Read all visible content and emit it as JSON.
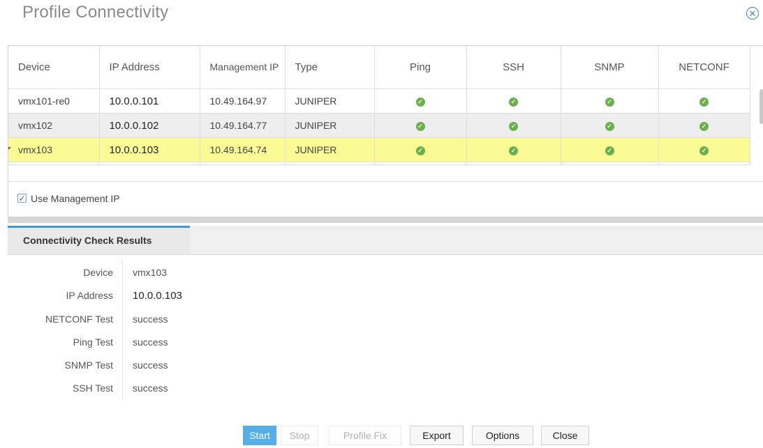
{
  "dialog": {
    "title": "Profile Connectivity",
    "close_icon": "close-circle-icon"
  },
  "table": {
    "columns": {
      "device": "Device",
      "ip_address": "IP Address",
      "management_ip": "Management IP",
      "type": "Type",
      "ping": "Ping",
      "ssh": "SSH",
      "snmp": "SNMP",
      "netconf": "NETCONF"
    },
    "rows": [
      {
        "device": "vmx101-re0",
        "ip_address": "10.0.0.101",
        "management_ip": "10.49.164.97",
        "type": "JUNIPER"
      },
      {
        "device": "vmx102",
        "ip_address": "10.0.0.102",
        "management_ip": "10.49.164.77",
        "type": "JUNIPER"
      },
      {
        "device": "vmx103",
        "ip_address": "10.0.0.103",
        "management_ip": "10.49.164.74",
        "type": "JUNIPER"
      }
    ],
    "status_icon": "check-circle-icon",
    "status_color": "#6ab04c",
    "selected_row_color": "#fbfb96"
  },
  "use_management_ip": {
    "label": "Use Management IP",
    "checked": true
  },
  "results_tab": {
    "label": "Connectivity Check Results"
  },
  "results": [
    {
      "label": "Device",
      "value": "vmx103"
    },
    {
      "label": "IP Address",
      "value": "10.0.0.103"
    },
    {
      "label": "NETCONF Test",
      "value": "success"
    },
    {
      "label": "Ping Test",
      "value": "success"
    },
    {
      "label": "SNMP Test",
      "value": "success"
    },
    {
      "label": "SSH Test",
      "value": "success"
    }
  ],
  "buttons": {
    "start": "Start",
    "stop": "Stop",
    "profile_fix": "Profile Fix",
    "export": "Export",
    "options": "Options",
    "close": "Close"
  },
  "accent_color": "#55aee8"
}
